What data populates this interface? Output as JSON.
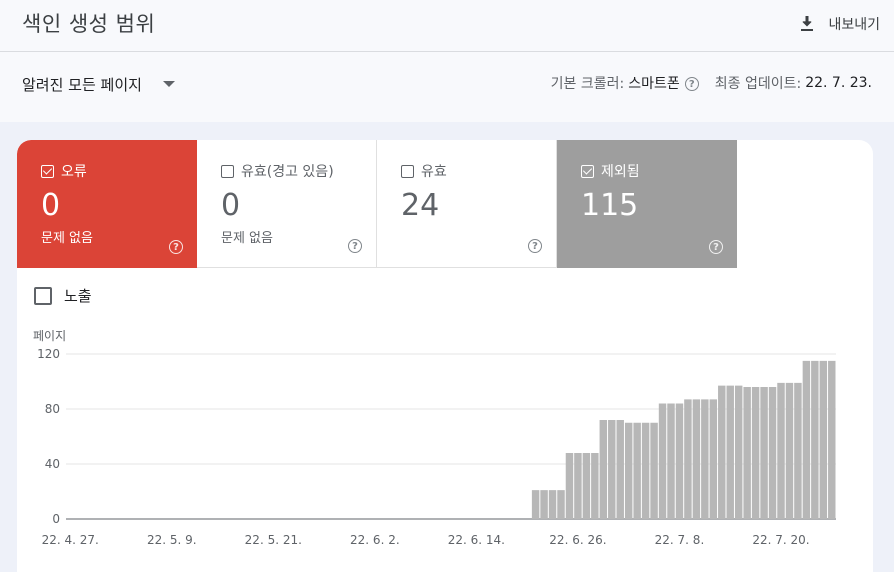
{
  "header": {
    "title": "색인 생성 범위",
    "export_label": "내보내기"
  },
  "filter": {
    "scope_label": "알려진 모든 페이지",
    "crawler_label": "기본 크롤러:",
    "crawler_value": "스마트폰",
    "updated_label": "최종 업데이트:",
    "updated_value": "22. 7. 23."
  },
  "tiles": [
    {
      "label": "오류",
      "value": "0",
      "sub": "문제 없음",
      "checked": true
    },
    {
      "label": "유효(경고 있음)",
      "value": "0",
      "sub": "문제 없음",
      "checked": false
    },
    {
      "label": "유효",
      "value": "24",
      "sub": "",
      "checked": false
    },
    {
      "label": "제외됨",
      "value": "115",
      "sub": "",
      "checked": true
    }
  ],
  "impressions": {
    "label": "노출",
    "checked": false
  },
  "colors": {
    "error": "#db4437",
    "excluded": "#9e9e9e",
    "bar": "#b7b7b7"
  },
  "chart_data": {
    "type": "bar",
    "ylabel": "페이지",
    "ylim": [
      0,
      120
    ],
    "yticks": [
      0,
      40,
      80,
      120
    ],
    "xticks": [
      "22. 4. 27.",
      "22. 5. 9.",
      "22. 5. 21.",
      "22. 6. 2.",
      "22. 6. 14.",
      "22. 6. 26.",
      "22. 7. 8.",
      "22. 7. 20."
    ],
    "x_start": "22. 4. 27.",
    "values": [
      0,
      0,
      0,
      0,
      0,
      0,
      0,
      0,
      0,
      0,
      0,
      0,
      0,
      0,
      0,
      0,
      0,
      0,
      0,
      0,
      0,
      0,
      0,
      0,
      0,
      0,
      0,
      0,
      0,
      0,
      0,
      0,
      0,
      0,
      0,
      0,
      0,
      0,
      0,
      0,
      0,
      0,
      0,
      0,
      0,
      0,
      0,
      0,
      0,
      0,
      0,
      0,
      0,
      0,
      0,
      21,
      21,
      21,
      21,
      48,
      48,
      48,
      48,
      72,
      72,
      72,
      70,
      70,
      70,
      70,
      84,
      84,
      84,
      87,
      87,
      87,
      87,
      97,
      97,
      97,
      96,
      96,
      96,
      96,
      99,
      99,
      99,
      115,
      115,
      115,
      115
    ]
  }
}
